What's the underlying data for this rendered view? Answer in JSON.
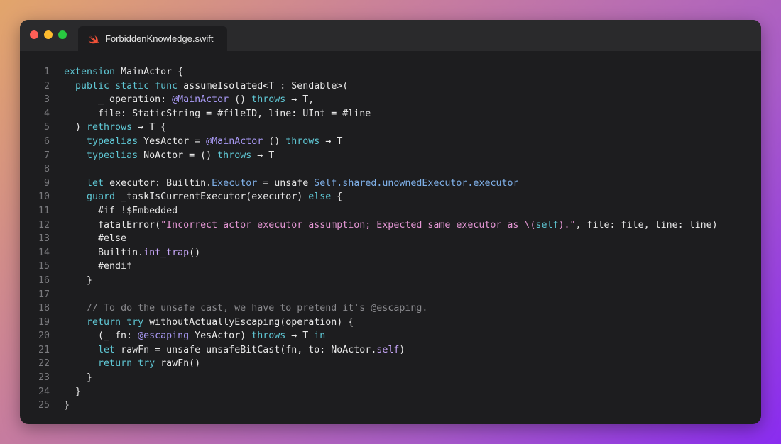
{
  "window": {
    "tab_title": "ForbiddenKnowledge.swift",
    "tab_icon": "swift-icon"
  },
  "colors": {
    "keyword": "#5fc7d4",
    "attribute": "#a99af5",
    "type": "#7fb0e8",
    "string": "#e497d4",
    "comment": "#8a8a8e",
    "identifier": "#c6a6f7",
    "plain": "#e8e8e8",
    "line_number": "#7a7a7e"
  },
  "code_lines": [
    {
      "n": "1",
      "tokens": [
        [
          "keyword",
          "extension"
        ],
        [
          "plain",
          " MainActor {"
        ]
      ]
    },
    {
      "n": "2",
      "tokens": [
        [
          "plain",
          "  "
        ],
        [
          "keyword",
          "public"
        ],
        [
          "plain",
          " "
        ],
        [
          "keyword",
          "static"
        ],
        [
          "plain",
          " "
        ],
        [
          "keyword",
          "func"
        ],
        [
          "plain",
          " assumeIsolated<T : Sendable>("
        ]
      ]
    },
    {
      "n": "3",
      "tokens": [
        [
          "plain",
          "      _ operation: "
        ],
        [
          "attribute",
          "@MainActor"
        ],
        [
          "plain",
          " () "
        ],
        [
          "keyword",
          "throws"
        ],
        [
          "plain",
          " → T,"
        ]
      ]
    },
    {
      "n": "4",
      "tokens": [
        [
          "plain",
          "      file: StaticString = #fileID, line: UInt = #line"
        ]
      ]
    },
    {
      "n": "5",
      "tokens": [
        [
          "plain",
          "  ) "
        ],
        [
          "keyword",
          "rethrows"
        ],
        [
          "plain",
          " → T {"
        ]
      ]
    },
    {
      "n": "6",
      "tokens": [
        [
          "plain",
          "    "
        ],
        [
          "keyword",
          "typealias"
        ],
        [
          "plain",
          " YesActor = "
        ],
        [
          "attribute",
          "@MainActor"
        ],
        [
          "plain",
          " () "
        ],
        [
          "keyword",
          "throws"
        ],
        [
          "plain",
          " → T"
        ]
      ]
    },
    {
      "n": "7",
      "tokens": [
        [
          "plain",
          "    "
        ],
        [
          "keyword",
          "typealias"
        ],
        [
          "plain",
          " NoActor = () "
        ],
        [
          "keyword",
          "throws"
        ],
        [
          "plain",
          " → T"
        ]
      ]
    },
    {
      "n": "8",
      "tokens": [
        [
          "plain",
          ""
        ]
      ]
    },
    {
      "n": "9",
      "tokens": [
        [
          "plain",
          "    "
        ],
        [
          "keyword",
          "let"
        ],
        [
          "plain",
          " executor: Builtin."
        ],
        [
          "type",
          "Executor"
        ],
        [
          "plain",
          " = unsafe "
        ],
        [
          "type",
          "Self.shared.unownedExecutor.executor"
        ]
      ]
    },
    {
      "n": "10",
      "tokens": [
        [
          "plain",
          "    "
        ],
        [
          "keyword",
          "guard"
        ],
        [
          "plain",
          " _taskIsCurrentExecutor(executor) "
        ],
        [
          "keyword",
          "else"
        ],
        [
          "plain",
          " {"
        ]
      ]
    },
    {
      "n": "11",
      "tokens": [
        [
          "plain",
          "      #if !$Embedded"
        ]
      ]
    },
    {
      "n": "12",
      "tokens": [
        [
          "plain",
          "      fatalError("
        ],
        [
          "string",
          "\"Incorrect actor executor assumption; Expected same executor as \\("
        ],
        [
          "keyword",
          "self"
        ],
        [
          "string",
          ").\""
        ],
        [
          "plain",
          ", file: file, line: line)"
        ]
      ]
    },
    {
      "n": "13",
      "tokens": [
        [
          "plain",
          "      #else"
        ]
      ]
    },
    {
      "n": "14",
      "tokens": [
        [
          "plain",
          "      Builtin."
        ],
        [
          "ident",
          "int_trap"
        ],
        [
          "plain",
          "()"
        ]
      ]
    },
    {
      "n": "15",
      "tokens": [
        [
          "plain",
          "      #endif"
        ]
      ]
    },
    {
      "n": "16",
      "tokens": [
        [
          "plain",
          "    }"
        ]
      ]
    },
    {
      "n": "17",
      "tokens": [
        [
          "plain",
          ""
        ]
      ]
    },
    {
      "n": "18",
      "tokens": [
        [
          "plain",
          "    "
        ],
        [
          "comment",
          "// To do the unsafe cast, we have to pretend it's @escaping."
        ]
      ]
    },
    {
      "n": "19",
      "tokens": [
        [
          "plain",
          "    "
        ],
        [
          "keyword",
          "return"
        ],
        [
          "plain",
          " "
        ],
        [
          "keyword",
          "try"
        ],
        [
          "plain",
          " withoutActuallyEscaping(operation) {"
        ]
      ]
    },
    {
      "n": "20",
      "tokens": [
        [
          "plain",
          "      (_ fn: "
        ],
        [
          "attribute",
          "@escaping"
        ],
        [
          "plain",
          " YesActor) "
        ],
        [
          "keyword",
          "throws"
        ],
        [
          "plain",
          " → T "
        ],
        [
          "keyword",
          "in"
        ]
      ]
    },
    {
      "n": "21",
      "tokens": [
        [
          "plain",
          "      "
        ],
        [
          "keyword",
          "let"
        ],
        [
          "plain",
          " rawFn = unsafe unsafeBitCast(fn, to: NoActor."
        ],
        [
          "ident",
          "self"
        ],
        [
          "plain",
          ")"
        ]
      ]
    },
    {
      "n": "22",
      "tokens": [
        [
          "plain",
          "      "
        ],
        [
          "keyword",
          "return"
        ],
        [
          "plain",
          " "
        ],
        [
          "keyword",
          "try"
        ],
        [
          "plain",
          " rawFn()"
        ]
      ]
    },
    {
      "n": "23",
      "tokens": [
        [
          "plain",
          "    }"
        ]
      ]
    },
    {
      "n": "24",
      "tokens": [
        [
          "plain",
          "  }"
        ]
      ]
    },
    {
      "n": "25",
      "tokens": [
        [
          "plain",
          "}"
        ]
      ]
    }
  ]
}
